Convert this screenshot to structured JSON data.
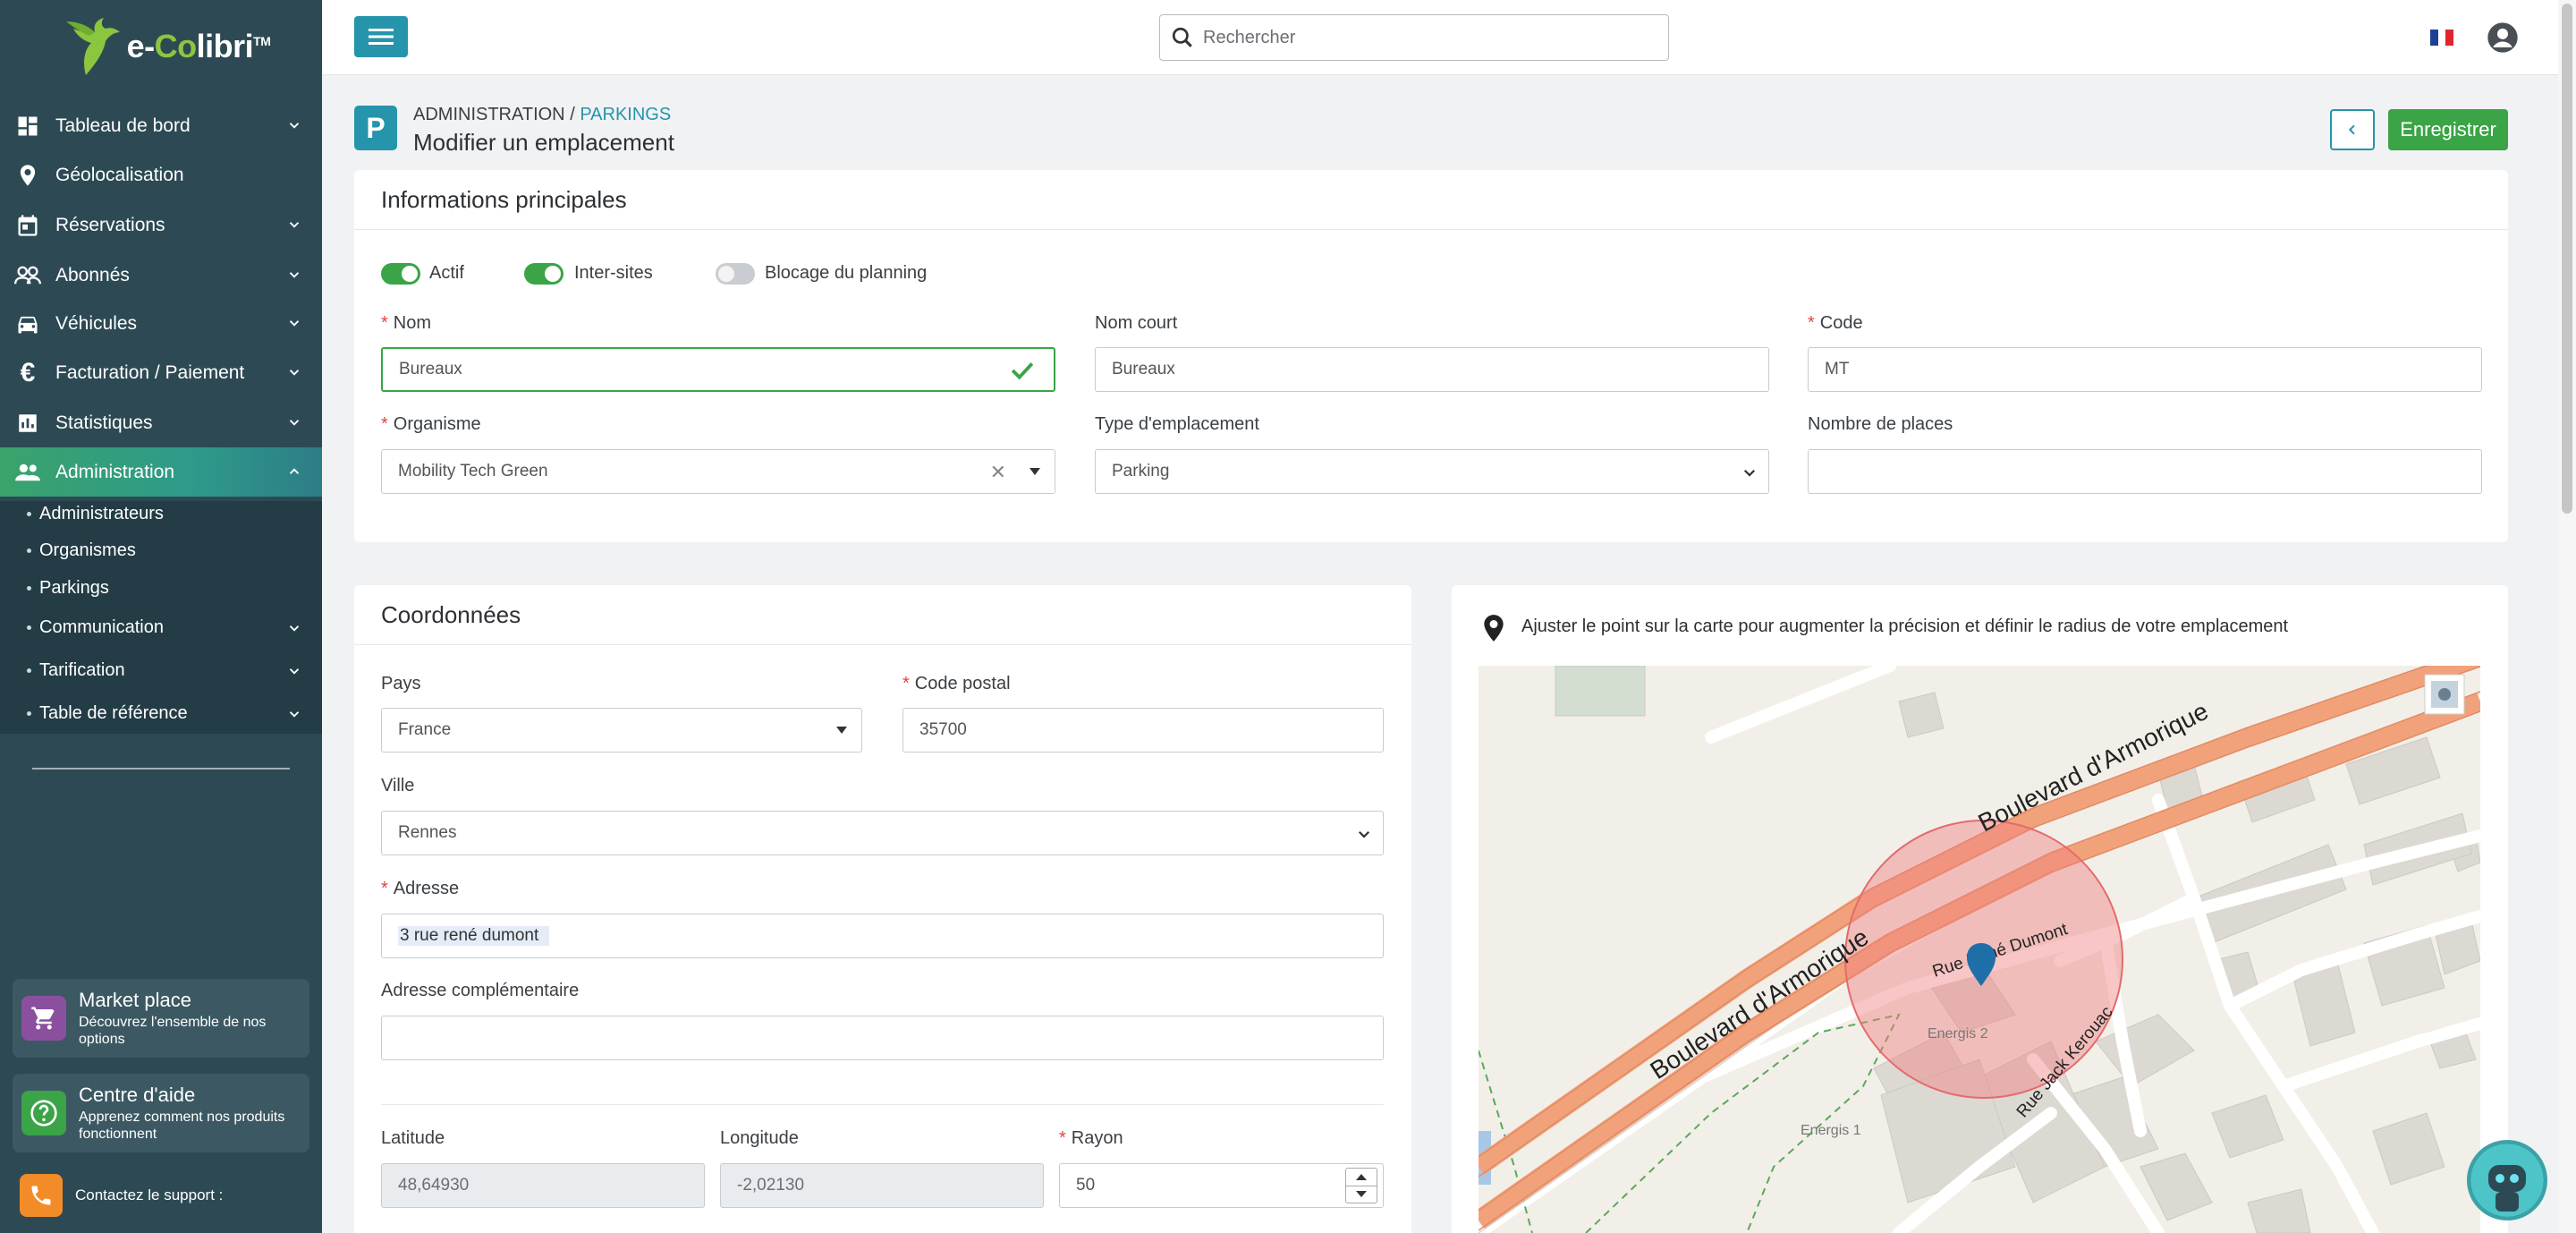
{
  "brand": {
    "name_prefix": "e-",
    "name_co": "Co",
    "name_rest": "libri",
    "tm": "TM"
  },
  "topbar": {
    "search_placeholder": "Rechercher"
  },
  "sidebar": {
    "items": [
      {
        "label": "Tableau de bord",
        "icon": "dashboard-icon"
      },
      {
        "label": "Géolocalisation",
        "icon": "map-pin-icon"
      },
      {
        "label": "Réservations",
        "icon": "calendar-icon"
      },
      {
        "label": "Abonnés",
        "icon": "users-icon"
      },
      {
        "label": "Véhicules",
        "icon": "car-icon"
      },
      {
        "label": "Facturation / Paiement",
        "icon": "euro-icon"
      },
      {
        "label": "Statistiques",
        "icon": "bar-chart-icon"
      },
      {
        "label": "Administration",
        "icon": "admin-users-icon"
      }
    ],
    "sub_items": [
      {
        "label": "Administrateurs"
      },
      {
        "label": "Organismes"
      },
      {
        "label": "Parkings"
      },
      {
        "label": "Communication"
      },
      {
        "label": "Tarification"
      },
      {
        "label": "Table de référence"
      }
    ],
    "marketplace": {
      "title": "Market place",
      "subtitle": "Découvrez l'ensemble de nos options"
    },
    "help": {
      "title": "Centre d'aide",
      "subtitle": "Apprenez comment nos produits fonctionnent"
    },
    "support": {
      "label": "Contactez le support :"
    }
  },
  "header": {
    "breadcrumb_root": "ADMINISTRATION",
    "breadcrumb_sep": " / ",
    "breadcrumb_current": "PARKINGS",
    "title": "Modifier un emplacement",
    "page_icon_letter": "P",
    "save_label": "Enregistrer"
  },
  "main_info": {
    "title": "Informations principales",
    "toggles": [
      {
        "label": "Actif",
        "on": true
      },
      {
        "label": "Inter-sites",
        "on": true
      },
      {
        "label": "Blocage du planning",
        "on": false
      }
    ],
    "nom": {
      "label": "Nom",
      "value": "Bureaux"
    },
    "nom_court": {
      "label": "Nom court",
      "value": "Bureaux"
    },
    "code": {
      "label": "Code",
      "value": "MT"
    },
    "organisme": {
      "label": "Organisme",
      "value": "Mobility Tech Green"
    },
    "type": {
      "label": "Type d'emplacement",
      "value": "Parking"
    },
    "places": {
      "label": "Nombre de places",
      "value": ""
    }
  },
  "coords": {
    "title": "Coordonnées",
    "pays": {
      "label": "Pays",
      "value": "France"
    },
    "code_postal": {
      "label": "Code postal",
      "value": "35700"
    },
    "ville": {
      "label": "Ville",
      "value": "Rennes"
    },
    "adresse": {
      "label": "Adresse",
      "value": "3 rue rené dumont"
    },
    "adresse_comp": {
      "label": "Adresse complémentaire",
      "value": ""
    },
    "latitude": {
      "label": "Latitude",
      "value": "48,64930"
    },
    "longitude": {
      "label": "Longitude",
      "value": "-2,02130"
    },
    "rayon": {
      "label": "Rayon",
      "value": "50"
    }
  },
  "map": {
    "hint": "Ajuster le point sur la carte pour augmenter la précision et définir le radius de votre emplacement",
    "labels": {
      "boulevard_top": "Boulevard d'Armorique",
      "boulevard_bottom": "Boulevard d'Armorique",
      "rue_dumont": "Rue René Dumont",
      "rue_kerouac": "Rue Jack Kerouac",
      "energis2": "Energis 2",
      "energis1": "Energis 1"
    }
  },
  "colors": {
    "sidebar": "#2d4a54",
    "accent": "#2694ab",
    "success": "#3aa447",
    "required": "#e0443c"
  }
}
